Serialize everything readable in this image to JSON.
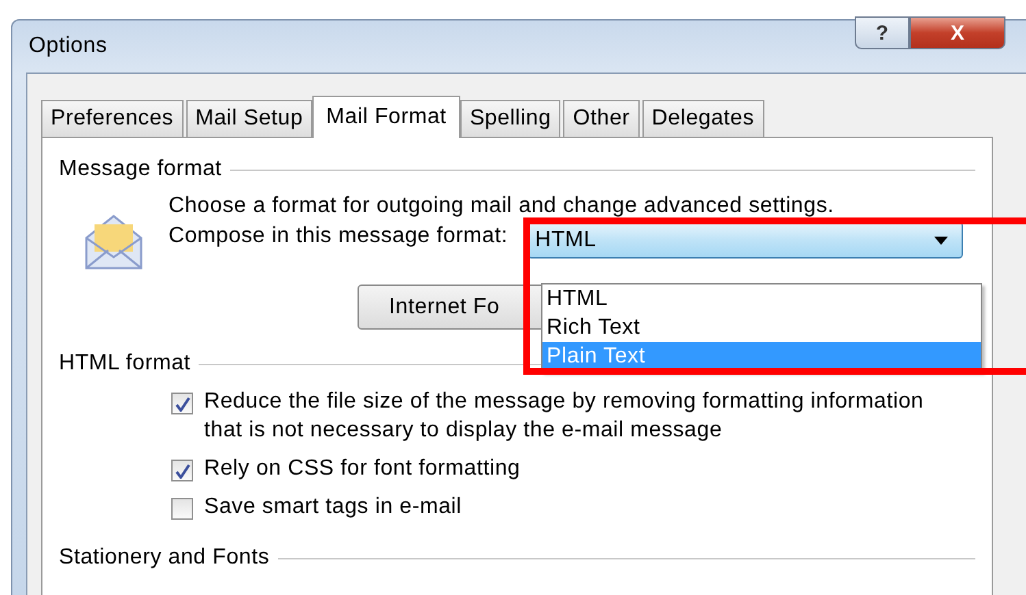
{
  "window": {
    "title": "Options",
    "buttons": [
      {
        "kind": "help",
        "label": "?"
      },
      {
        "kind": "close",
        "label": "X"
      }
    ]
  },
  "tabs": [
    {
      "label": "Preferences",
      "selected": false
    },
    {
      "label": "Mail Setup",
      "selected": false
    },
    {
      "label": "Mail Format",
      "selected": true
    },
    {
      "label": "Spelling",
      "selected": false
    },
    {
      "label": "Other",
      "selected": false
    },
    {
      "label": "Delegates",
      "selected": false
    }
  ],
  "message_format": {
    "heading": "Message format",
    "description": "Choose a format for outgoing mail and change advanced settings.",
    "compose_label": "Compose in this message format:",
    "compose_value": "HTML",
    "expanded": true,
    "options": [
      {
        "label": "HTML",
        "selected": false
      },
      {
        "label": "Rich Text",
        "selected": false
      },
      {
        "label": "Plain Text",
        "selected": true
      }
    ],
    "button": "Internet Fo",
    "highlighted": true
  },
  "html_format": {
    "heading": "HTML format",
    "options": [
      {
        "label": "Reduce the file size of the message by removing formatting information that is not necessary to display the e-mail message",
        "checked": true
      },
      {
        "label": "Rely on CSS for font formatting",
        "checked": true
      },
      {
        "label": "Save smart tags in e-mail",
        "checked": false
      }
    ]
  },
  "stationery": {
    "heading": "Stationery and Fonts"
  }
}
